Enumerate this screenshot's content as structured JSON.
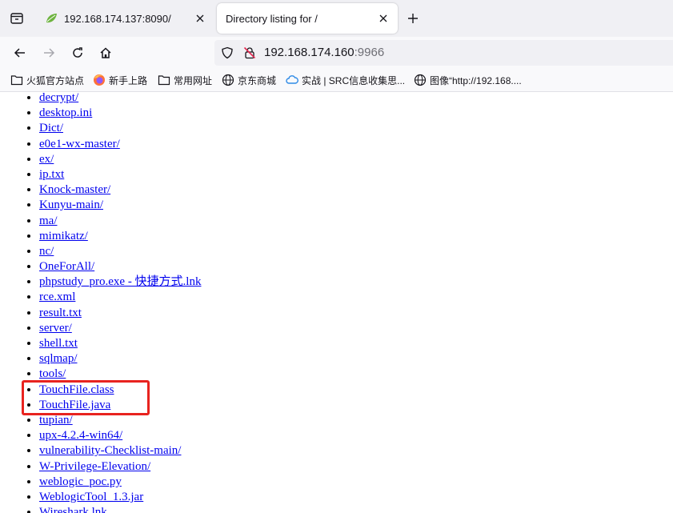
{
  "tabs": [
    {
      "title": "192.168.174.137:8090/",
      "active": false,
      "favicon": "leaf-icon"
    },
    {
      "title": "Directory listing for /",
      "active": true,
      "favicon": ""
    }
  ],
  "url": {
    "host": "192.168.174.160",
    "port": ":9966"
  },
  "bookmarks": [
    {
      "label": "火狐官方站点",
      "icon": "folder-icon"
    },
    {
      "label": "新手上路",
      "icon": "firefox-icon"
    },
    {
      "label": "常用网址",
      "icon": "folder-icon"
    },
    {
      "label": "京东商城",
      "icon": "globe-icon"
    },
    {
      "label": "实战 | SRC信息收集思...",
      "icon": "cloud-icon"
    },
    {
      "label": "图像“http://192.168....",
      "icon": "globe-icon"
    }
  ],
  "files": [
    "decrypt/",
    "desktop.ini",
    "Dict/",
    "e0e1-wx-master/",
    "ex/",
    "ip.txt",
    "Knock-master/",
    "Kunyu-main/",
    "ma/",
    "mimikatz/",
    "nc/",
    "OneForAll/",
    "phpstudy_pro.exe - 快捷方式.lnk",
    "rce.xml",
    "result.txt",
    "server/",
    "shell.txt",
    "sqlmap/",
    "tools/",
    "TouchFile.class",
    "TouchFile.java",
    "tupian/",
    "upx-4.2.4-win64/",
    "vulnerability-Checklist-main/",
    "W-Privilege-Elevation/",
    "weblogic_poc.py",
    "WeblogicTool_1.3.jar",
    "Wireshark.lnk"
  ],
  "colors": {
    "link": "#0000ee",
    "highlight": "#e8231f"
  }
}
